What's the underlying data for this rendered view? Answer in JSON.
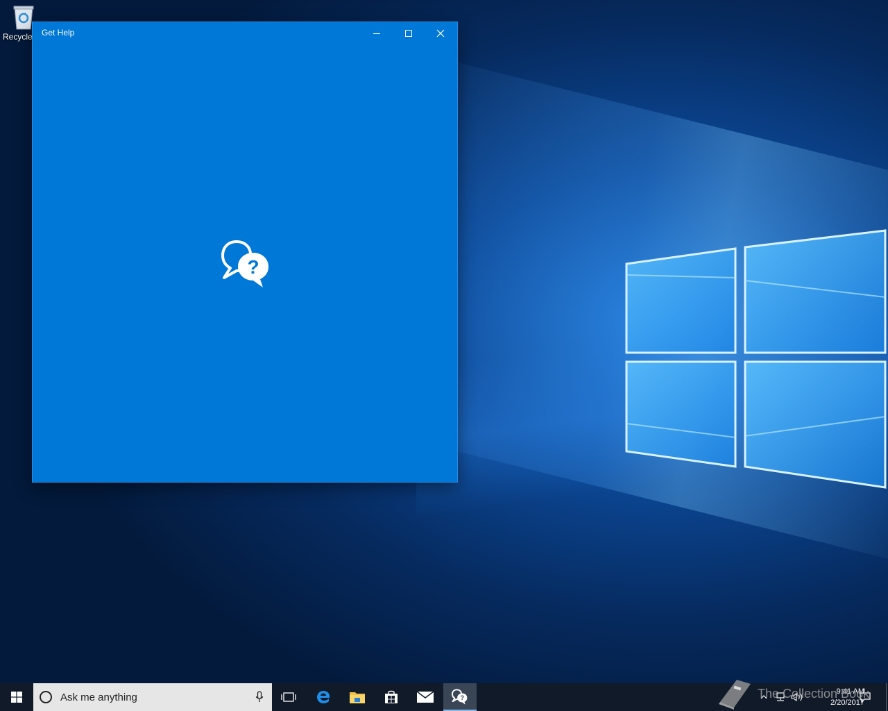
{
  "desktop": {
    "icons": [
      {
        "label": "Recycle Bin",
        "icon": "recycle-bin-icon"
      }
    ]
  },
  "window": {
    "title": "Get Help",
    "controls": [
      "minimize-icon",
      "maximize-icon",
      "close-icon"
    ],
    "splash_icon": "help-chat-bubbles-icon",
    "accent_color": "#0078d7"
  },
  "taskbar": {
    "start_icon": "windows-start-icon",
    "search": {
      "placeholder": "Ask me anything"
    },
    "pinned": [
      {
        "name": "task-view",
        "icon": "task-view-icon"
      },
      {
        "name": "edge",
        "icon": "edge-icon"
      },
      {
        "name": "file-explorer",
        "icon": "folder-icon"
      },
      {
        "name": "store",
        "icon": "store-icon"
      },
      {
        "name": "mail",
        "icon": "mail-icon"
      },
      {
        "name": "get-help",
        "icon": "help-chat-icon",
        "active": true
      }
    ],
    "clock": {
      "time": "9:41 AM",
      "date": "2/20/2017"
    }
  },
  "watermark": {
    "text": "The Collection Book"
  }
}
